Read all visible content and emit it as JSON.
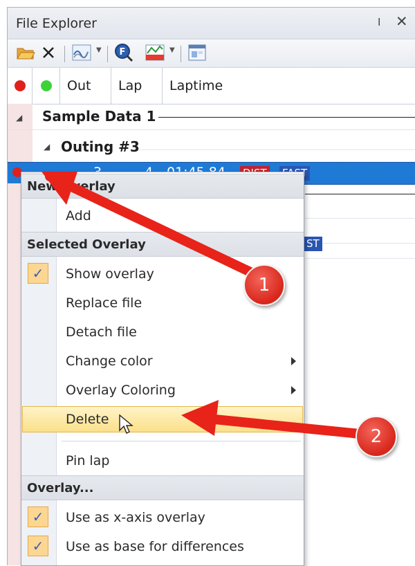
{
  "panel": {
    "title": "File Explorer",
    "pin_glyph": "ⵏ",
    "close_glyph": "✕",
    "toolbar": {
      "icons": [
        "open-folder-icon",
        "delete-x-icon",
        "overlay-wave-icon",
        "zoom-f-icon",
        "chart-colors-icon",
        "data-table-icon"
      ]
    },
    "columns": [
      "Out",
      "Lap",
      "Laptime"
    ]
  },
  "tree": {
    "group": "Sample Data 1",
    "subgroup": "Outing #3",
    "selected_row": {
      "out": "3",
      "lap": "4",
      "laptime": "01:45.84",
      "badges": [
        "DIST",
        "FAST"
      ]
    },
    "partial_badge": "ST"
  },
  "context_menu": {
    "header_new": "New Overlay",
    "add": "Add",
    "header_selected": "Selected Overlay",
    "show_overlay": "Show overlay",
    "replace_file": "Replace file",
    "detach_file": "Detach file",
    "change_color": "Change color",
    "overlay_coloring": "Overlay Coloring",
    "delete": "Delete",
    "pin_lap": "Pin lap",
    "header_overlay": "Overlay...",
    "use_x_axis": "Use as x-axis overlay",
    "use_base": "Use as base for differences",
    "check_glyph": "✓"
  },
  "annotations": {
    "callout_1": "1",
    "callout_2": "2",
    "arrow_color": "#e8231a"
  },
  "colors": {
    "selection": "#1f7ad6",
    "dist_badge": "#c5222a",
    "fast_badge": "#2a55b3",
    "red_dot": "#e0201c",
    "green_dot": "#3ed23a"
  }
}
